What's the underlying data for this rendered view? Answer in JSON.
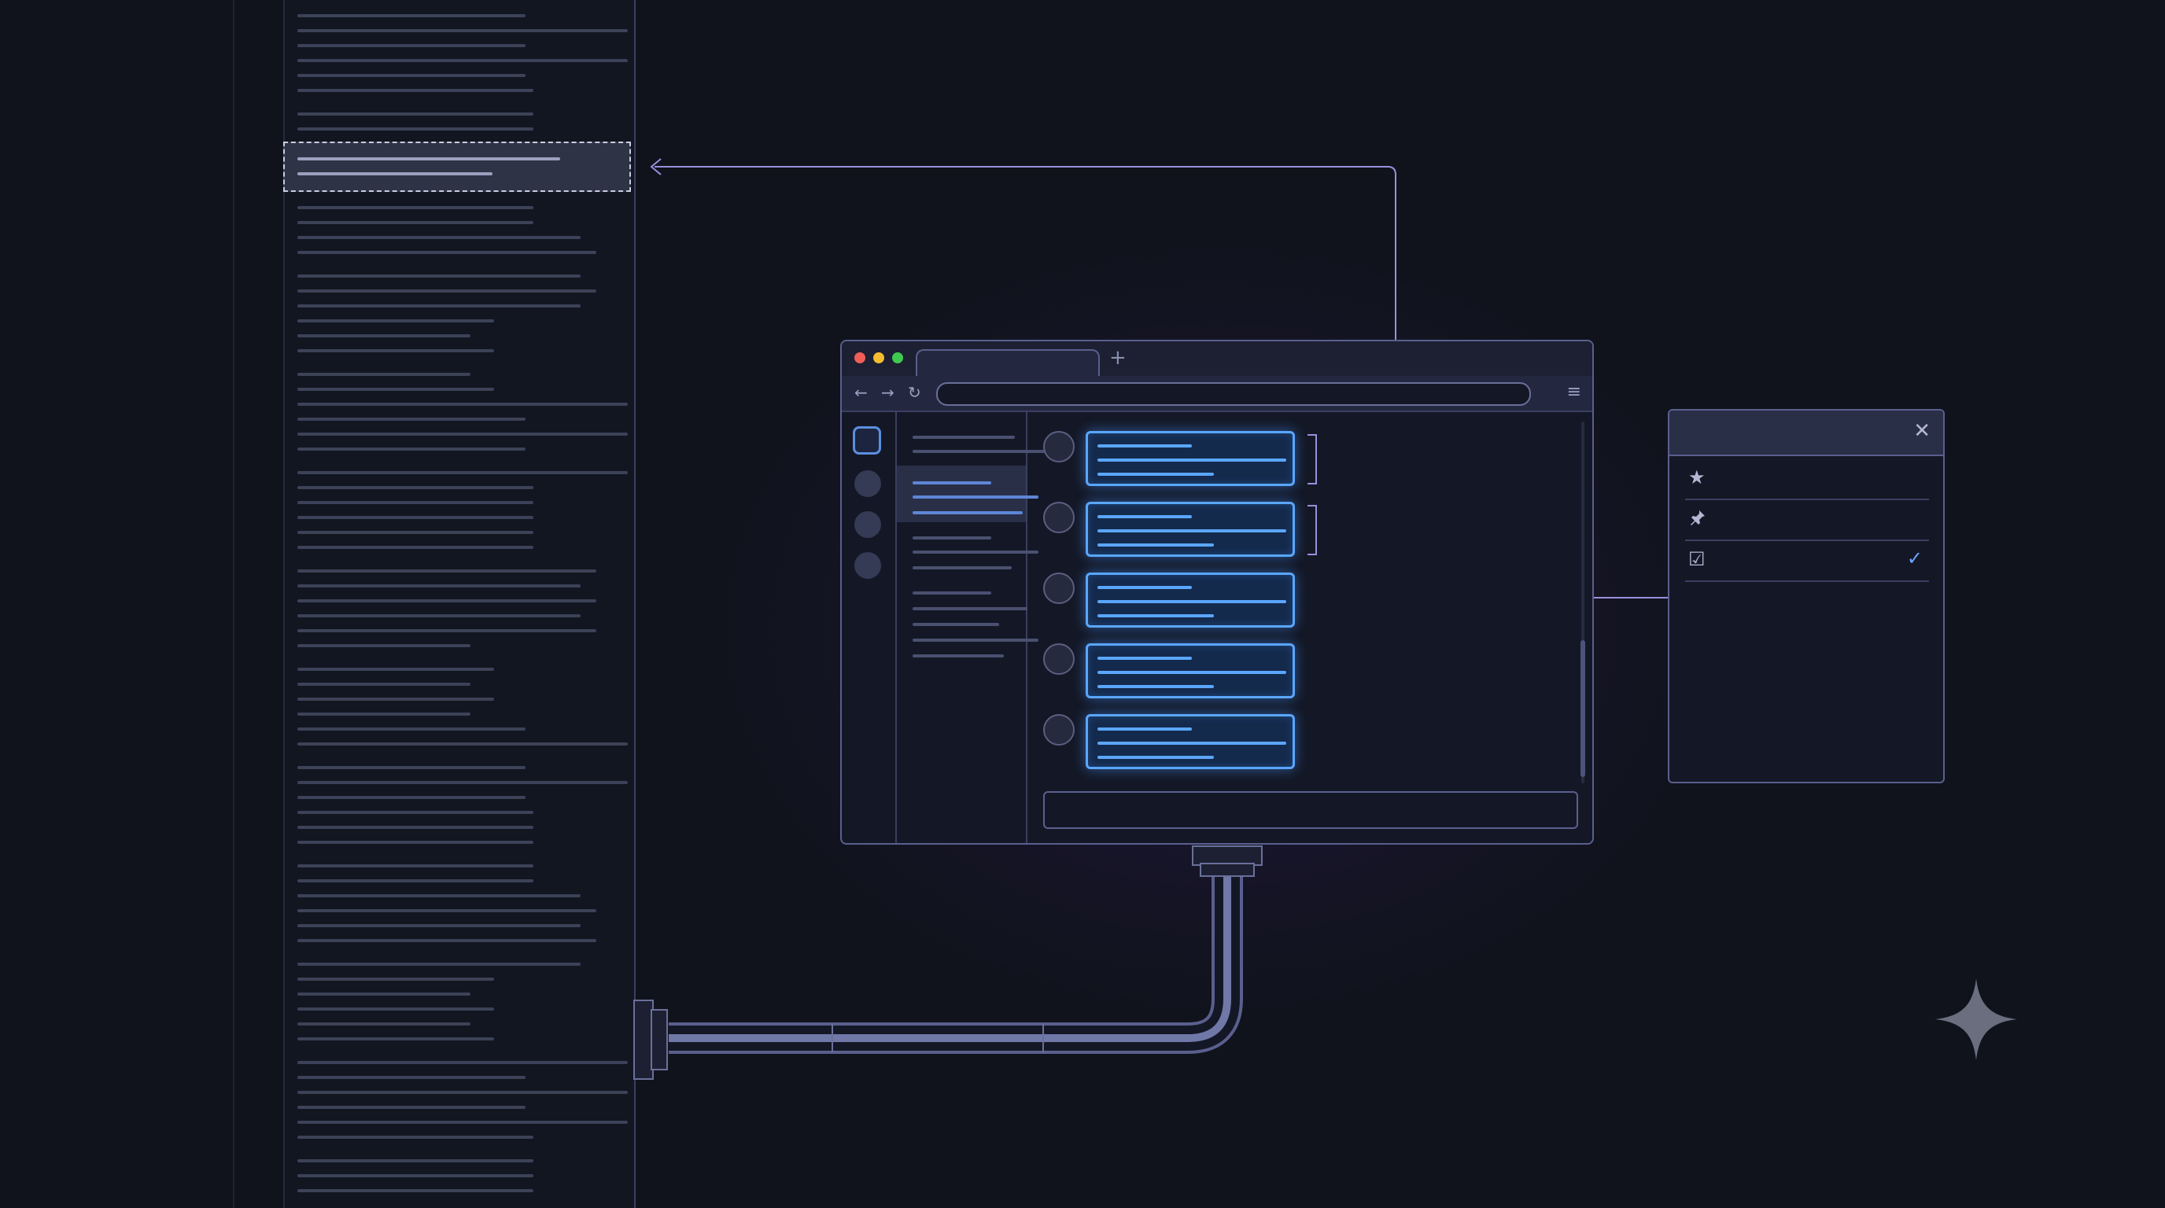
{
  "browser": {
    "new_tab_symbol": "+",
    "back_symbol": "←",
    "forward_symbol": "→",
    "reload_symbol": "↻",
    "menu_symbol": "≡",
    "message_count": 5
  },
  "panel": {
    "close_symbol": "✕",
    "rows": [
      {
        "icon": "star-icon",
        "glyph": "★",
        "checked": false
      },
      {
        "icon": "pin-icon",
        "glyph": "📌",
        "checked": false
      },
      {
        "icon": "checkbox-icon",
        "glyph": "☑",
        "checked": true
      }
    ],
    "check_symbol": "✓"
  },
  "colors": {
    "background": "#10131c",
    "accent_blue": "#5aa6ff",
    "accent_purple": "#9a8fdc",
    "traffic_red": "#ef5f57",
    "traffic_yellow": "#f5bd2f",
    "traffic_green": "#3fc950"
  },
  "icons": [
    "sparkle-icon",
    "close-icon",
    "star-icon",
    "pin-icon",
    "checkbox-icon",
    "check-icon",
    "back-arrow-icon",
    "forward-arrow-icon",
    "reload-icon",
    "menu-icon"
  ]
}
